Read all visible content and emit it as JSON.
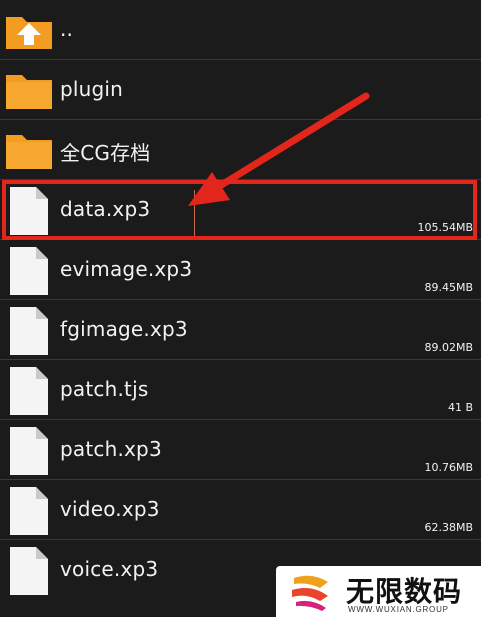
{
  "files": [
    {
      "name": "..",
      "type": "folder-up",
      "size": ""
    },
    {
      "name": "plugin",
      "type": "folder",
      "size": ""
    },
    {
      "name": "全CG存档",
      "type": "folder",
      "size": ""
    },
    {
      "name": "data.xp3",
      "type": "file",
      "size": "105.54MB"
    },
    {
      "name": "evimage.xp3",
      "type": "file",
      "size": "89.45MB"
    },
    {
      "name": "fgimage.xp3",
      "type": "file",
      "size": "89.02MB"
    },
    {
      "name": "patch.tjs",
      "type": "file",
      "size": "41 B"
    },
    {
      "name": "patch.xp3",
      "type": "file",
      "size": "10.76MB"
    },
    {
      "name": "video.xp3",
      "type": "file",
      "size": "62.38MB"
    },
    {
      "name": "voice.xp3",
      "type": "file",
      "size": ""
    }
  ],
  "highlighted_file": "data.xp3",
  "watermark": {
    "title": "无限数码",
    "subtitle": "WWW.WUXIAN.GROUP"
  },
  "colors": {
    "background": "#1b1b1b",
    "folder": "#f39c22",
    "highlight": "#e3261b",
    "text": "#f2f2f2"
  }
}
